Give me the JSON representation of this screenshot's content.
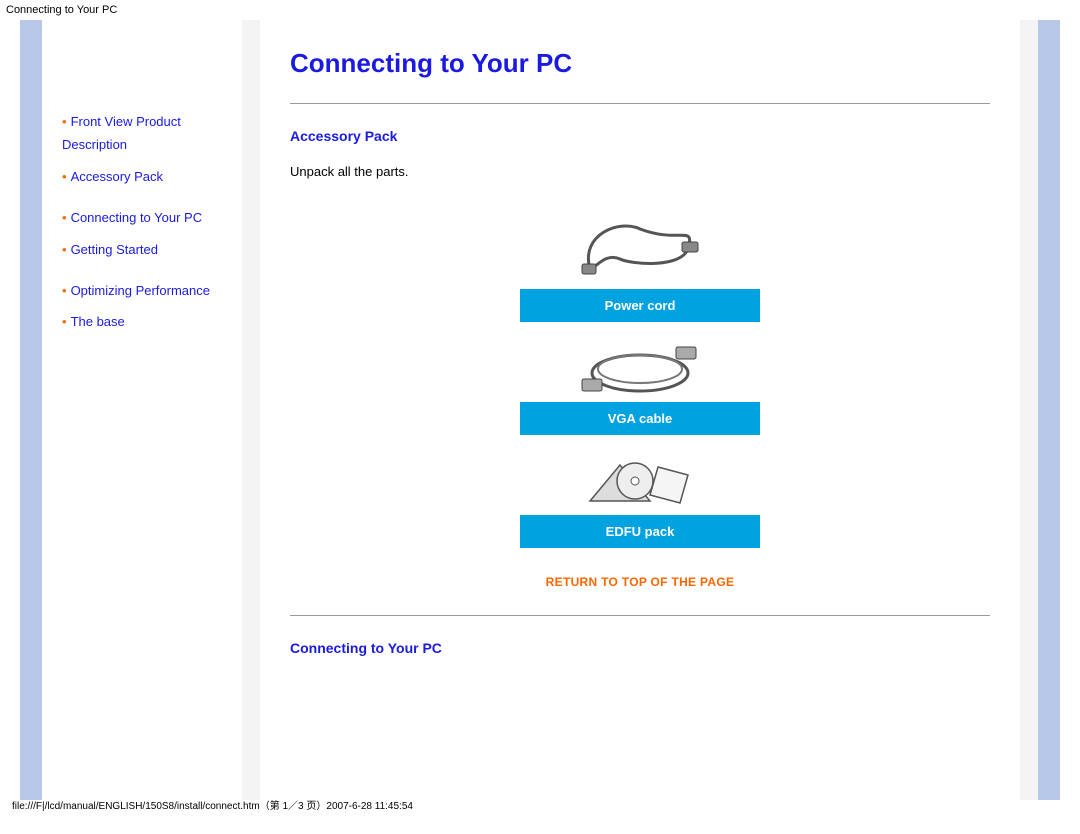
{
  "header": {
    "title": "Connecting to Your PC"
  },
  "sidebar": {
    "items": [
      {
        "label": "Front View Product Description"
      },
      {
        "label": "Accessory Pack"
      },
      {
        "label": "Connecting to Your PC"
      },
      {
        "label": "Getting Started"
      },
      {
        "label": "Optimizing Performance"
      },
      {
        "label": "The base"
      }
    ]
  },
  "content": {
    "title": "Connecting to Your PC",
    "section1": {
      "heading": "Accessory Pack",
      "intro": "Unpack all the parts.",
      "items": [
        "Power cord",
        "VGA cable",
        "EDFU pack"
      ],
      "return": "RETURN TO TOP OF THE PAGE"
    },
    "section2": {
      "heading": "Connecting to Your PC"
    }
  },
  "footer": {
    "path": "file:///F|/lcd/manual/ENGLISH/150S8/install/connect.htm（第 1／3 页）2007-6-28 11:45:54"
  }
}
